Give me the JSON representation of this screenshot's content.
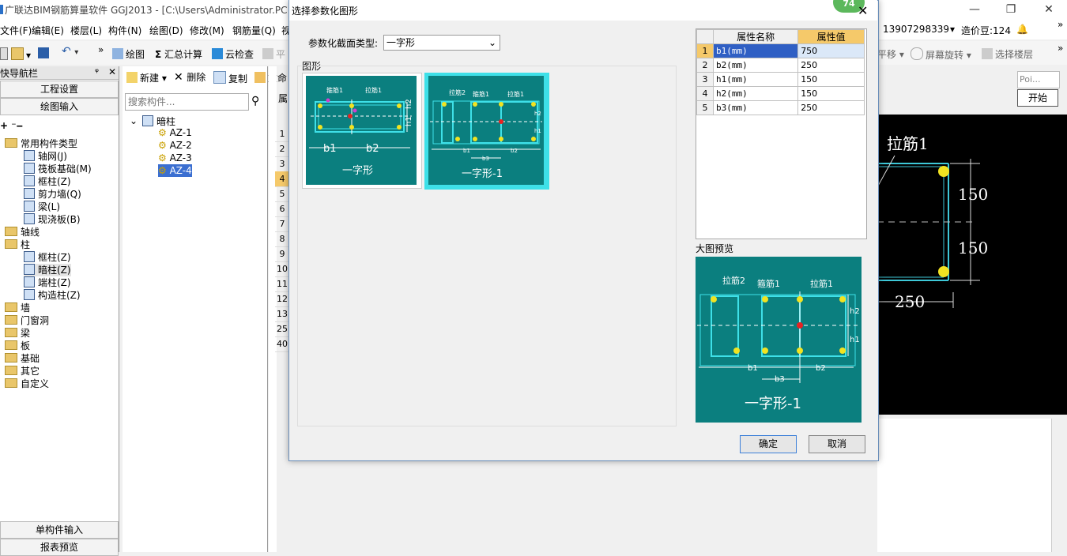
{
  "app": {
    "title": "广联达BIM钢筋算量软件 GGJ2013 - [C:\\Users\\Administrator.PC"
  },
  "menu": [
    "文件(F)",
    "编辑(E)",
    "楼层(L)",
    "构件(N)",
    "绘图(D)",
    "修改(M)",
    "钢筋量(Q)",
    "视"
  ],
  "menu_right": {
    "phone": "13907298339",
    "coins": "造价豆:124"
  },
  "toolbar": {
    "draw": "绘图",
    "sum": "汇总计算",
    "cloud_check": "云检查",
    "flat": "平",
    "flat_move": "平移",
    "rotate": "屏幕旋转",
    "select_floor": "选择楼层"
  },
  "nav": {
    "title": "快导航栏",
    "pin": "ᵠ",
    "project_settings": "工程设置",
    "draw_input": "绘图输入",
    "single_input": "单构件输入",
    "report_preview": "报表预览",
    "tree": [
      {
        "label": "常用构件类型",
        "level": 0,
        "kind": "folder"
      },
      {
        "label": "轴网(J)",
        "level": 1,
        "kind": "icon"
      },
      {
        "label": "筏板基础(M)",
        "level": 1,
        "kind": "icon"
      },
      {
        "label": "框柱(Z)",
        "level": 1,
        "kind": "icon"
      },
      {
        "label": "剪力墙(Q)",
        "level": 1,
        "kind": "icon"
      },
      {
        "label": "梁(L)",
        "level": 1,
        "kind": "icon"
      },
      {
        "label": "现浇板(B)",
        "level": 1,
        "kind": "icon"
      },
      {
        "label": "轴线",
        "level": 0,
        "kind": "folder"
      },
      {
        "label": "柱",
        "level": 0,
        "kind": "folder"
      },
      {
        "label": "框柱(Z)",
        "level": 1,
        "kind": "icon"
      },
      {
        "label": "暗柱(Z)",
        "level": 1,
        "kind": "icon"
      },
      {
        "label": "端柱(Z)",
        "level": 1,
        "kind": "icon"
      },
      {
        "label": "构造柱(Z)",
        "level": 1,
        "kind": "icon"
      },
      {
        "label": "墙",
        "level": 0,
        "kind": "folder"
      },
      {
        "label": "门窗洞",
        "level": 0,
        "kind": "folder"
      },
      {
        "label": "梁",
        "level": 0,
        "kind": "folder"
      },
      {
        "label": "板",
        "level": 0,
        "kind": "folder"
      },
      {
        "label": "基础",
        "level": 0,
        "kind": "folder"
      },
      {
        "label": "其它",
        "level": 0,
        "kind": "folder"
      },
      {
        "label": "自定义",
        "level": 0,
        "kind": "folder"
      }
    ]
  },
  "components": {
    "new": "新建",
    "delete": "删除",
    "copy": "复制",
    "rename": "重命",
    "search_placeholder": "搜索构件...",
    "root": "暗柱",
    "items": [
      "AZ-1",
      "AZ-2",
      "AZ-3",
      "AZ-4"
    ],
    "selected": "AZ-4"
  },
  "grid": {
    "header": "属",
    "rows": [
      "1",
      "2",
      "3",
      "4",
      "5",
      "6",
      "7",
      "8",
      "9",
      "10",
      "11",
      "12",
      "13",
      "25",
      "40"
    ]
  },
  "dialog": {
    "title": "选择参数化图形",
    "badge": "74",
    "type_label": "参数化截面类型:",
    "type_value": "一字形",
    "shapes_label": "图形",
    "shapes": [
      {
        "name": "一字形",
        "labels": [
          "箍筋1",
          "拉筋1",
          "b1",
          "b2",
          "h1",
          "h2"
        ]
      },
      {
        "name": "一字形-1",
        "labels": [
          "拉筋2",
          "箍筋1",
          "拉筋1",
          "b3",
          "b1",
          "b2",
          "h2",
          "h1"
        ]
      }
    ],
    "table": {
      "headers": [
        "属性名称",
        "属性值"
      ],
      "rows": [
        {
          "n": "1",
          "name": "b1(mm)",
          "value": "750"
        },
        {
          "n": "2",
          "name": "b2(mm)",
          "value": "250"
        },
        {
          "n": "3",
          "name": "h1(mm)",
          "value": "150"
        },
        {
          "n": "4",
          "name": "h2(mm)",
          "value": "150"
        },
        {
          "n": "5",
          "name": "b3(mm)",
          "value": "250"
        }
      ]
    },
    "preview_label": "大图预览",
    "preview": {
      "caption": "一字形-1",
      "tie2": "拉筋2",
      "stirrup1": "箍筋1",
      "tie1": "拉筋1",
      "b1": "b1",
      "b2": "b2",
      "b3": "b3",
      "h1": "h1",
      "h2": "h2"
    },
    "ok": "确定",
    "cancel": "取消"
  },
  "canvas": {
    "tie1": "拉筋1",
    "h_top": "150",
    "h_bottom": "150",
    "width": "250"
  },
  "floating": {
    "poi": "Poi...",
    "start": "开始"
  }
}
